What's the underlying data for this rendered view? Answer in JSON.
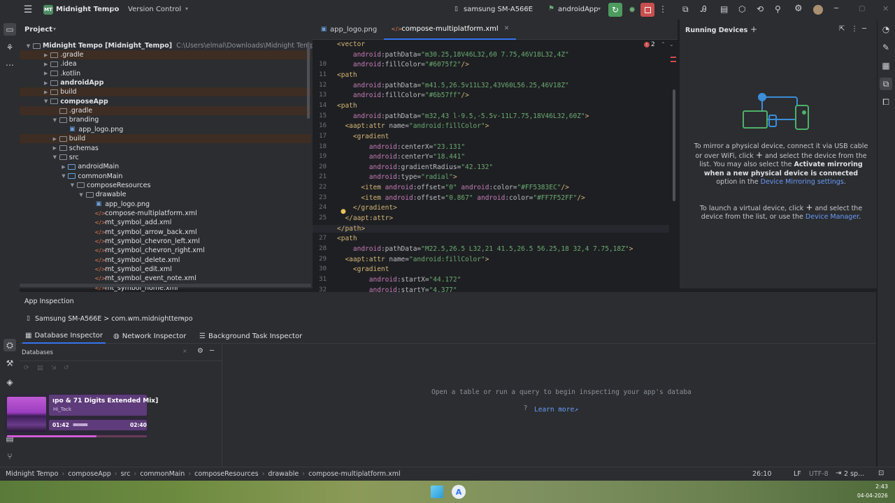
{
  "titlebar": {
    "project_badge": "MT",
    "project_name": "Midnight Tempo",
    "vcs": "Version Control",
    "device": "samsung SM-A566E",
    "run_config": "androidApp"
  },
  "project_panel": {
    "title": "Project",
    "root": "Midnight Tempo [Midnight_Tempo]",
    "root_path": "C:\\Users\\elmal\\Downloads\\Midnight Tempo",
    "items": [
      {
        "label": ".gradle",
        "indent": 2,
        "kind": "folder",
        "excluded": true,
        "arrow": "right"
      },
      {
        "label": ".idea",
        "indent": 2,
        "kind": "folder",
        "excluded": false,
        "arrow": "right"
      },
      {
        "label": ".kotlin",
        "indent": 2,
        "kind": "folder",
        "excluded": false,
        "arrow": "right"
      },
      {
        "label": "androidApp",
        "indent": 2,
        "kind": "module",
        "excluded": false,
        "arrow": "right"
      },
      {
        "label": "build",
        "indent": 2,
        "kind": "folder",
        "excluded": true,
        "arrow": "right"
      },
      {
        "label": "composeApp",
        "indent": 2,
        "kind": "module",
        "excluded": false,
        "arrow": "down"
      },
      {
        "label": ".gradle",
        "indent": 3,
        "kind": "folder",
        "excluded": true,
        "arrow": ""
      },
      {
        "label": "branding",
        "indent": 3,
        "kind": "folder",
        "excluded": false,
        "arrow": "down"
      },
      {
        "label": "app_logo.png",
        "indent": 4,
        "kind": "png",
        "excluded": false,
        "arrow": ""
      },
      {
        "label": "build",
        "indent": 3,
        "kind": "folder",
        "excluded": true,
        "arrow": "right"
      },
      {
        "label": "schemas",
        "indent": 3,
        "kind": "folder",
        "excluded": false,
        "arrow": "right"
      },
      {
        "label": "src",
        "indent": 3,
        "kind": "folder",
        "excluded": false,
        "arrow": "down"
      },
      {
        "label": "androidMain",
        "indent": 4,
        "kind": "srcfolder",
        "excluded": false,
        "arrow": "right"
      },
      {
        "label": "commonMain",
        "indent": 4,
        "kind": "srcfolder",
        "excluded": false,
        "arrow": "down"
      },
      {
        "label": "composeResources",
        "indent": 5,
        "kind": "folder",
        "excluded": false,
        "arrow": "down"
      },
      {
        "label": "drawable",
        "indent": 6,
        "kind": "folder",
        "excluded": false,
        "arrow": "down"
      },
      {
        "label": "app_logo.png",
        "indent": 7,
        "kind": "png",
        "excluded": false,
        "arrow": ""
      },
      {
        "label": "compose-multiplatform.xml",
        "indent": 7,
        "kind": "xml",
        "excluded": false,
        "arrow": ""
      },
      {
        "label": "mt_symbol_add.xml",
        "indent": 7,
        "kind": "xml",
        "excluded": false,
        "arrow": ""
      },
      {
        "label": "mt_symbol_arrow_back.xml",
        "indent": 7,
        "kind": "xml",
        "excluded": false,
        "arrow": ""
      },
      {
        "label": "mt_symbol_chevron_left.xml",
        "indent": 7,
        "kind": "xml",
        "excluded": false,
        "arrow": ""
      },
      {
        "label": "mt_symbol_chevron_right.xml",
        "indent": 7,
        "kind": "xml",
        "excluded": false,
        "arrow": ""
      },
      {
        "label": "mt_symbol_delete.xml",
        "indent": 7,
        "kind": "xml",
        "excluded": false,
        "arrow": ""
      },
      {
        "label": "mt_symbol_edit.xml",
        "indent": 7,
        "kind": "xml",
        "excluded": false,
        "arrow": ""
      },
      {
        "label": "mt_symbol_event_note.xml",
        "indent": 7,
        "kind": "xml",
        "excluded": false,
        "arrow": ""
      },
      {
        "label": "mt_symbol_home.xml",
        "indent": 7,
        "kind": "xml",
        "excluded": false,
        "arrow": ""
      }
    ]
  },
  "editor": {
    "tabs": [
      {
        "label": "app_logo.png",
        "active": false
      },
      {
        "label": "compose-multiplatform.xml",
        "active": true
      }
    ],
    "error_count": "2",
    "lines": [
      {
        "n": "",
        "html": "<span class='tag'>&lt;vector</span>"
      },
      {
        "n": "",
        "html": "    <span class='ns'>android</span>:pathData=<span class='str'>\"m30.25,18V46L32,60 7.75,46V18L32,4Z\"</span>"
      },
      {
        "n": "10",
        "html": "    <span class='ns'>android</span>:fillColor=<span class='str'>\"#6075f2\"</span><span class='tag'>/&gt;</span>"
      },
      {
        "n": "11",
        "html": "<span class='tag'>&lt;path</span>"
      },
      {
        "n": "12",
        "html": "    <span class='ns'>android</span>:pathData=<span class='str'>\"m41.5,26.5v11L32,43V60L56.25,46V18Z\"</span>"
      },
      {
        "n": "13",
        "html": "    <span class='ns'>android</span>:fillColor=<span class='str'>\"#6b57ff\"</span><span class='tag'>/&gt;</span>"
      },
      {
        "n": "14",
        "html": "<span class='tag'>&lt;path</span>"
      },
      {
        "n": "15",
        "html": "    <span class='ns'>android</span>:pathData=<span class='str'>\"m32,43 l-9.5,-5.5v-11L7.75,18V46L32,60Z\"</span><span class='tag'>&gt;</span>"
      },
      {
        "n": "16",
        "html": "  <span class='tag'>&lt;aapt:attr</span> name=<span class='str'>\"android:fillColor\"</span><span class='tag'>&gt;</span>"
      },
      {
        "n": "17",
        "html": "    <span class='tag'>&lt;gradient</span>"
      },
      {
        "n": "18",
        "html": "        <span class='ns'>android</span>:centerX=<span class='str'>\"23.131\"</span>"
      },
      {
        "n": "19",
        "html": "        <span class='ns'>android</span>:centerY=<span class='str'>\"18.441\"</span>"
      },
      {
        "n": "20",
        "html": "        <span class='ns'>android</span>:gradientRadius=<span class='str'>\"42.132\"</span>"
      },
      {
        "n": "21",
        "html": "        <span class='ns'>android</span>:type=<span class='str'>\"radial\"</span><span class='tag'>&gt;</span>"
      },
      {
        "n": "22",
        "html": "      <span class='tag'>&lt;item</span> <span class='ns'>android</span>:offset=<span class='str'>\"0\"</span> <span class='ns'>android</span>:color=<span class='str'>\"#FF5383EC\"</span><span class='tag'>/&gt;</span>"
      },
      {
        "n": "23",
        "html": "      <span class='tag'>&lt;item</span> <span class='ns'>android</span>:offset=<span class='str'>\"0.867\"</span> <span class='ns'>android</span>:color=<span class='str'>\"#FF7F52FF\"</span><span class='tag'>/&gt;</span>"
      },
      {
        "n": "24",
        "html": "    <span class='tag'>&lt;/gradient&gt;</span>"
      },
      {
        "n": "25",
        "html": "  <span class='tag'>&lt;/aapt:attr&gt;</span>"
      },
      {
        "n": "26",
        "html": "<span class='tag'>&lt;/path&gt;</span>"
      },
      {
        "n": "27",
        "html": "<span class='tag'>&lt;path</span>"
      },
      {
        "n": "28",
        "html": "    <span class='ns'>android</span>:pathData=<span class='str'>\"M22.5,26.5 L32,21 41.5,26.5 56.25,18 32,4 7.75,18Z\"</span><span class='tag'>&gt;</span>"
      },
      {
        "n": "29",
        "html": "  <span class='tag'>&lt;aapt:attr</span> name=<span class='str'>\"android:fillColor\"</span><span class='tag'>&gt;</span>"
      },
      {
        "n": "30",
        "html": "    <span class='tag'>&lt;gradient</span>"
      },
      {
        "n": "31",
        "html": "        <span class='ns'>android</span>:startX=<span class='str'>\"44.172\"</span>"
      },
      {
        "n": "32",
        "html": "        <span class='ns'>android</span>:startY=<span class='str'>\"4.377\"</span>"
      }
    ]
  },
  "running_devices": {
    "title": "Running Devices",
    "p1_a": "To mirror a physical device, connect it via USB cable or over WiFi, click",
    "p1_b": "and select the device from the list. You may also select the",
    "p1_bold": "Activate mirroring when a new physical device is connected",
    "p1_c": "option in the",
    "p1_link": "Device Mirroring settings",
    "p2_a": "To launch a virtual device, click",
    "p2_b": "and select the device from the list, or use the",
    "p2_link": "Device Manager"
  },
  "inspection": {
    "title": "App Inspection",
    "process": "Samsung SM-A566E > com.wm.midnighttempo",
    "tabs": [
      "Database Inspector",
      "Network Inspector",
      "Background Task Inspector"
    ],
    "databases_label": "Databases",
    "empty_message": "Open a table or run a query to begin inspecting your app's databa",
    "learn_more": "Learn more↗"
  },
  "media": {
    "title": "ıpo & 71 Digits Extended Mix]",
    "artist": "Hi_Tack",
    "elapsed": "01:42",
    "total": "02:40",
    "progress": 0.64
  },
  "statusbar": {
    "breadcrumbs": [
      "Midnight Tempo",
      "composeApp",
      "src",
      "commonMain",
      "composeResources",
      "drawable",
      "compose-multiplatform.xml"
    ],
    "position": "26:10",
    "line_sep": "LF",
    "encoding": "UTF-8",
    "indent": "2 sp..."
  },
  "taskbar": {
    "time": "2:43",
    "date": "04-04-2026"
  },
  "colors": {
    "accent": "#3574f0",
    "excluded_bg": "#3d2d22",
    "run_green": "#4d9b5e",
    "stop_red": "#c94f4f"
  }
}
